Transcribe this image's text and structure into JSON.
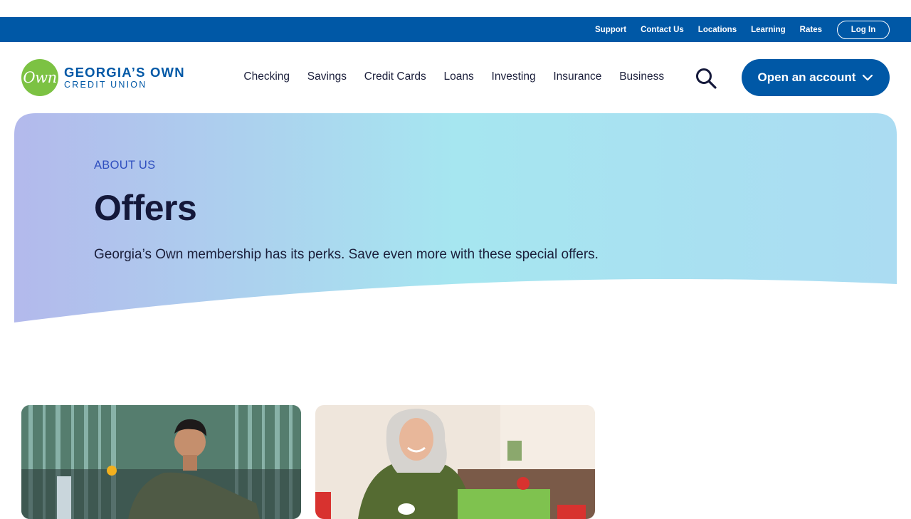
{
  "utility": {
    "links": [
      "Support",
      "Contact Us",
      "Locations",
      "Learning",
      "Rates"
    ],
    "login": "Log In"
  },
  "logo": {
    "mark": "Own",
    "line1": "GEORGIA’S OWN",
    "line2": "CREDIT UNION"
  },
  "nav": {
    "items": [
      "Checking",
      "Savings",
      "Credit Cards",
      "Loans",
      "Investing",
      "Insurance",
      "Business"
    ],
    "search_icon": "search-icon",
    "open_account": "Open an account"
  },
  "hero": {
    "eyebrow": "ABOUT US",
    "title": "Offers",
    "subtitle": "Georgia’s Own membership has its perks. Save even more with these special offers."
  },
  "colors": {
    "brand_blue": "#0058a6",
    "brand_green": "#7cc243",
    "hero_gradient_start": "#b3b9ec",
    "hero_gradient_mid": "#a6e6f0",
    "hero_gradient_end": "#abdcf2"
  }
}
